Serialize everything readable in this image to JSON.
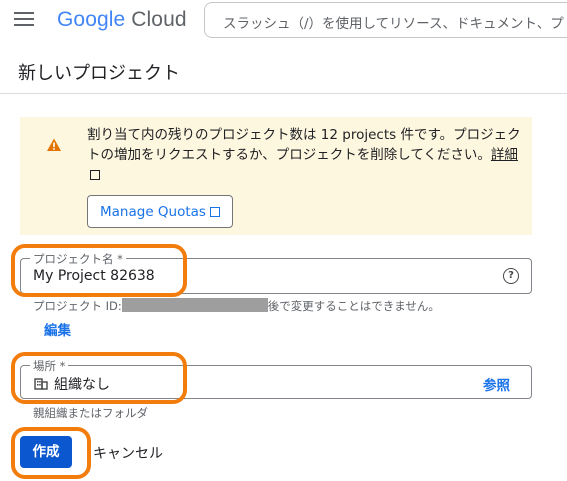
{
  "topbar": {
    "logo_google": "Google",
    "logo_cloud": "Cloud",
    "search_placeholder": "スラッシュ（/）を使用してリソース、ドキュメント、プ"
  },
  "page": {
    "title": "新しいプロジェクト"
  },
  "banner": {
    "message": "割り当て内の残りのプロジェクト数は 12 projects 件です。プロジェクトの増加をリクエストするか、プロジェクトを削除してください。",
    "detail_link": "詳細",
    "manage_button": "Manage Quotas"
  },
  "project_name": {
    "label": "プロジェクト名 *",
    "value": "My Project 82638",
    "help_icon": "help-circle-icon"
  },
  "project_id": {
    "prefix": "プロジェクト ID:",
    "suffix": "後で変更することはできません。",
    "edit_link": "編集"
  },
  "location": {
    "label": "場所 *",
    "value": "組織なし",
    "browse_link": "参照",
    "hint": "親組織またはフォルダ",
    "icon": "building-icon"
  },
  "actions": {
    "create": "作成",
    "cancel": "キャンセル"
  },
  "colors": {
    "accent": "#1a73e8",
    "primary_button": "#0b57d0",
    "banner_bg": "#fef7e0",
    "warning": "#e37400",
    "highlight": "#f37d0c"
  }
}
